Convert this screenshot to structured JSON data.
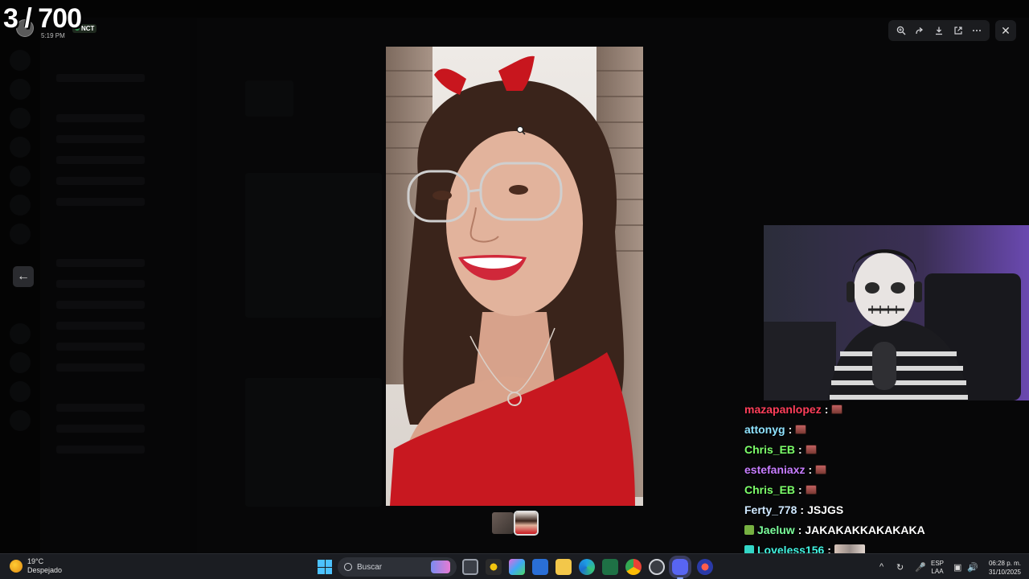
{
  "overlay": {
    "counter": "3 / 700"
  },
  "user_mini": {
    "badge": "NCT",
    "time": "5:19 PM"
  },
  "viewer_toolbar": {
    "zoom": "zoom-in-icon",
    "forward": "forward-icon",
    "download": "download-icon",
    "open": "open-external-icon",
    "more": "more-icon",
    "close": "close-icon"
  },
  "chat": [
    {
      "user": "mazapanlopez",
      "color": "#ff3f5a",
      "sep": ":",
      "message": "",
      "emote": "emote"
    },
    {
      "user": "attonyg",
      "color": "#8fe3ff",
      "sep": ":",
      "message": "",
      "emote": "emote"
    },
    {
      "user": "Chris_EB",
      "color": "#7cff6a",
      "sep": ":",
      "message": "",
      "emote": "emote"
    },
    {
      "user": "estefaniaxz",
      "color": "#c77dff",
      "sep": ":",
      "message": "",
      "emote": "emote"
    },
    {
      "user": "Chris_EB",
      "color": "#7cff6a",
      "sep": ":",
      "message": "",
      "emote": "emote"
    },
    {
      "user": "Ferty_778",
      "color": "#cfe8ff",
      "sep": ":",
      "message": "JSJGS",
      "emote": ""
    },
    {
      "user": "Jaeluw",
      "color": "#7cff9c",
      "sep": ":",
      "message": "JAKAKAKKAKAKAKA",
      "emote": "",
      "badge": "#76b041"
    },
    {
      "user": "Loveless156",
      "color": "#42f5e3",
      "sep": ":",
      "message": "",
      "emote": "wide",
      "badge": "#33d6c6"
    }
  ],
  "taskbar": {
    "weather_temp": "19°C",
    "weather_desc": "Despejado",
    "search_placeholder": "Buscar",
    "lang_1": "ESP",
    "lang_2": "LAA",
    "time": "06:28 p. m.",
    "date": "31/10/2025"
  }
}
